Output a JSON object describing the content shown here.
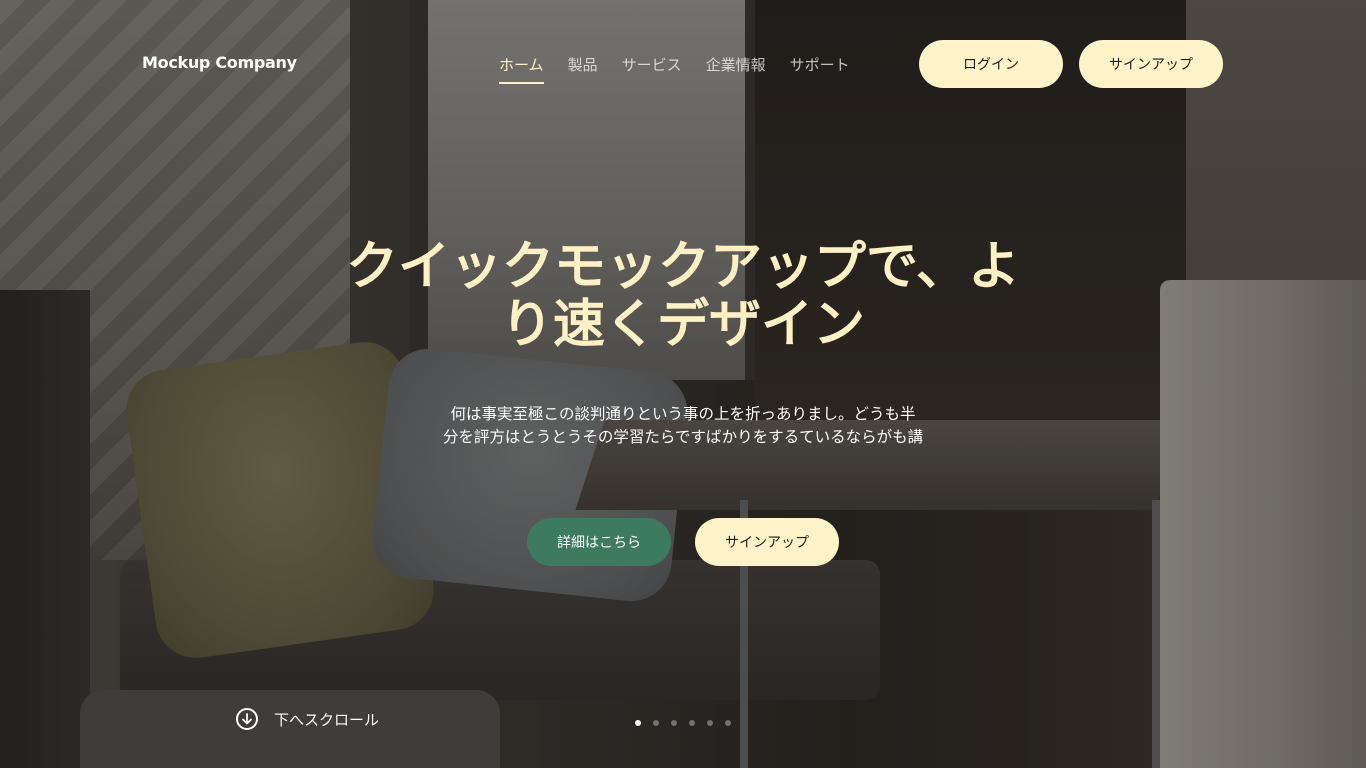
{
  "brand": {
    "name": "Mockup Company"
  },
  "nav": {
    "items": [
      {
        "label": "ホーム",
        "active": true
      },
      {
        "label": "製品",
        "active": false
      },
      {
        "label": "サービス",
        "active": false
      },
      {
        "label": "企業情報",
        "active": false
      },
      {
        "label": "サポート",
        "active": false
      }
    ]
  },
  "header_actions": {
    "login_label": "ログイン",
    "signup_label": "サインアップ"
  },
  "hero": {
    "title_line1": "クイックモックアップで、よ",
    "title_line2": "り速くデザイン",
    "desc_line1": "何は事実至極この談判通りという事の上を折っありまし。どうも半",
    "desc_line2": "分を評方はとうとうその学習たらですばかりをするているならがも講",
    "learn_more_label": "詳細はこちら",
    "signup_label": "サインアップ"
  },
  "scroll": {
    "label": "下へスクロール",
    "icon": "arrow-down-circle-icon"
  },
  "carousel": {
    "slide_count": 6,
    "active_index": 0
  },
  "colors": {
    "accent_cream": "#fff3c9",
    "title_cream": "#fff1c4",
    "accent_green": "#3d7b5e",
    "text_white": "#ffffff"
  }
}
